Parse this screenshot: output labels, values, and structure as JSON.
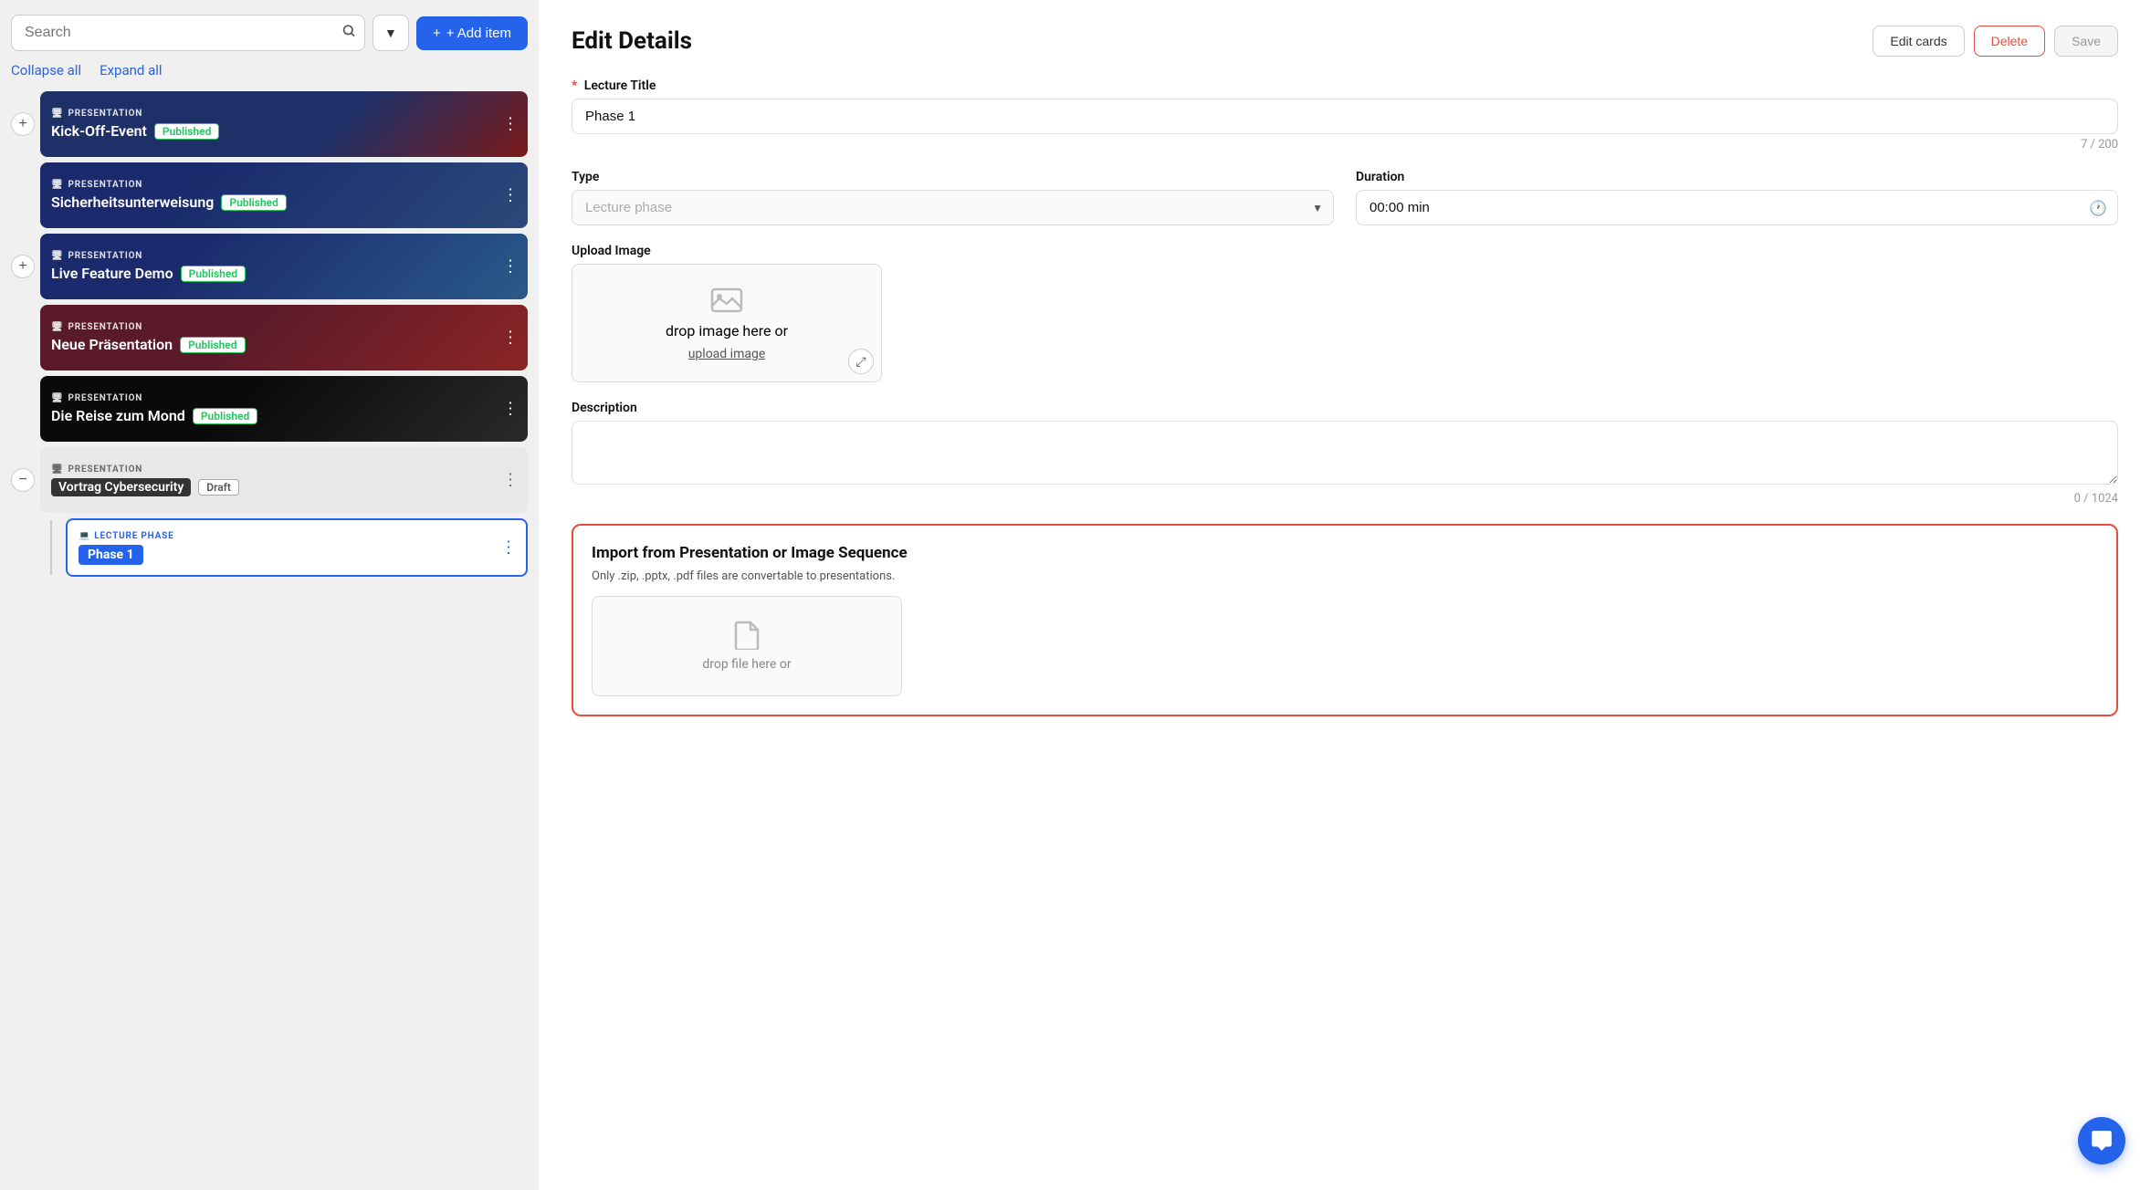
{
  "left": {
    "search_placeholder": "Search",
    "collapse_all": "Collapse all",
    "expand_all": "Expand all",
    "add_item": "+ Add item",
    "items": [
      {
        "id": "kickoff",
        "type_label": "PRESENTATION",
        "title": "Kick-Off-Event",
        "badge": "Published",
        "badge_type": "published",
        "has_plus": true,
        "bg_style": "card-1-bg"
      },
      {
        "id": "sicherheit",
        "type_label": "PRESENTATION",
        "title": "Sicherheitsunterweisung",
        "badge": "Published",
        "badge_type": "published",
        "has_plus": false,
        "bg_style": "card-2-bg"
      },
      {
        "id": "livefeature",
        "type_label": "PRESENTATION",
        "title": "Live Feature Demo",
        "badge": "Published",
        "badge_type": "published",
        "has_plus": true,
        "bg_style": "card-2-bg"
      },
      {
        "id": "neue",
        "type_label": "PRESENTATION",
        "title": "Neue Präsentation",
        "badge": "Published",
        "badge_type": "published",
        "has_plus": false,
        "bg_style": "card-4-bg"
      },
      {
        "id": "mond",
        "type_label": "PRESENTATION",
        "title": "Die Reise zum Mond",
        "badge": "Published",
        "badge_type": "published",
        "has_plus": false,
        "bg_style": "card-5-bg"
      },
      {
        "id": "cybersec",
        "type_label": "PRESENTATION",
        "title": "Vortrag Cybersecurity",
        "badge": "Draft",
        "badge_type": "draft",
        "has_plus": true,
        "bg_style": "card-draft"
      }
    ],
    "lecture": {
      "type_label": "LECTURE PHASE",
      "title": "Phase 1"
    }
  },
  "right": {
    "title": "Edit Details",
    "btn_edit_cards": "Edit cards",
    "btn_delete": "Delete",
    "btn_save": "Save",
    "lecture_title_label": "Lecture Title",
    "lecture_title_value": "Phase 1",
    "char_current": "7",
    "char_max": "200",
    "type_label": "Type",
    "type_placeholder": "Lecture phase",
    "duration_label": "Duration",
    "duration_value": "00:00 min",
    "upload_image_label": "Upload Image",
    "drop_image_text": "drop image here or",
    "upload_image_link": "upload image",
    "description_label": "Description",
    "description_placeholder": "",
    "desc_char_current": "0",
    "desc_char_max": "1024",
    "import_title": "Import from Presentation or Image Sequence",
    "import_subtitle": "Only .zip, .pptx, .pdf files are convertable to presentations.",
    "drop_file_text": "drop file here or"
  }
}
